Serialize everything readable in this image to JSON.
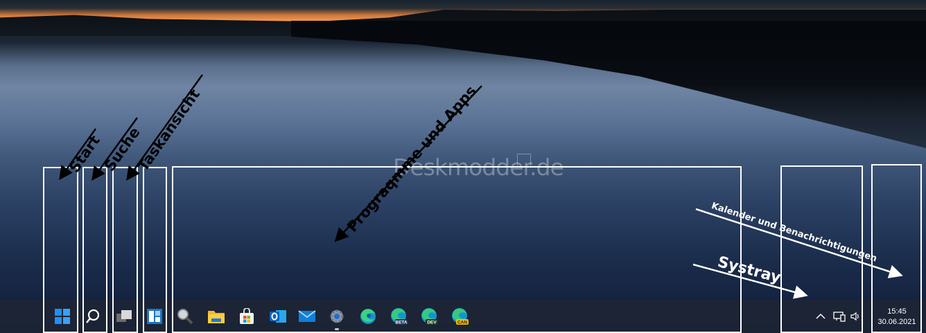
{
  "annotations": {
    "start": "Start",
    "search": "Suche",
    "taskview": "Taskansicht",
    "programs": "Prograqmme und Apps",
    "calendar": "Kalender und Benachrichtigungen",
    "systray": "Systray"
  },
  "watermark": "Deskmodder.de",
  "taskbar": {
    "icons": [
      "windows-start-icon",
      "search-icon",
      "task-view-icon",
      "widgets-icon",
      "magnifier-icon",
      "file-explorer-icon",
      "microsoft-store-icon",
      "outlook-icon",
      "mail-icon",
      "settings-icon",
      "edge-icon",
      "edge-beta-icon",
      "edge-dev-icon",
      "edge-canary-icon"
    ],
    "badges": {
      "beta": "BETA",
      "dev": "DEV",
      "canary": "CAN"
    },
    "tray_icons": [
      "chevron-up-icon",
      "network-icon",
      "volume-icon"
    ],
    "clock": {
      "time": "15:45",
      "date": "30.06.2021"
    }
  },
  "colors": {
    "accent": "#0078d4",
    "annotation_box": "#ffffff"
  }
}
